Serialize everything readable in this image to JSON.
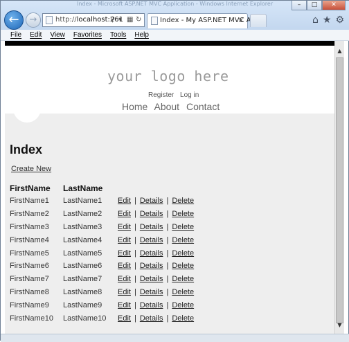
{
  "browser": {
    "caption_ghost": "Index - Microsoft ASP.NET MVC Application - Windows Internet Explorer",
    "address": {
      "prefix": "http://",
      "host": "localhost:261"
    },
    "tab_title": "Index - My ASP.NET MVC A...",
    "tab_close": "×",
    "window_buttons": {
      "minimize": "–",
      "maximize": "□",
      "close": "✕"
    },
    "menu": [
      "File",
      "Edit",
      "View",
      "Favorites",
      "Tools",
      "Help"
    ],
    "icons": {
      "back": "back-arrow-icon",
      "forward": "forward-arrow-icon",
      "home": "home-icon",
      "favorites": "star-icon",
      "tools": "gear-icon",
      "search": "search-icon",
      "compat": "compatibility-icon",
      "refresh": "refresh-icon"
    }
  },
  "site": {
    "logo_text": "your logo here",
    "login_links": [
      "Register",
      "Log in"
    ],
    "nav": [
      "Home",
      "About",
      "Contact"
    ]
  },
  "page": {
    "title": "Index",
    "create_new": "Create New",
    "columns": [
      "FirstName",
      "LastName"
    ],
    "actions": [
      "Edit",
      "Details",
      "Delete"
    ],
    "action_separator": "|",
    "rows": [
      {
        "first": "FirstName1",
        "last": "LastName1"
      },
      {
        "first": "FirstName2",
        "last": "LastName2"
      },
      {
        "first": "FirstName3",
        "last": "LastName3"
      },
      {
        "first": "FirstName4",
        "last": "LastName4"
      },
      {
        "first": "FirstName5",
        "last": "LastName5"
      },
      {
        "first": "FirstName6",
        "last": "LastName6"
      },
      {
        "first": "FirstName7",
        "last": "LastName7"
      },
      {
        "first": "FirstName8",
        "last": "LastName8"
      },
      {
        "first": "FirstName9",
        "last": "LastName9"
      },
      {
        "first": "FirstName10",
        "last": "LastName10"
      }
    ]
  },
  "colors": {
    "page_bg": "#eeeeee",
    "header_bg": "#ffffff",
    "accent_back_button": "#1e67b8"
  }
}
